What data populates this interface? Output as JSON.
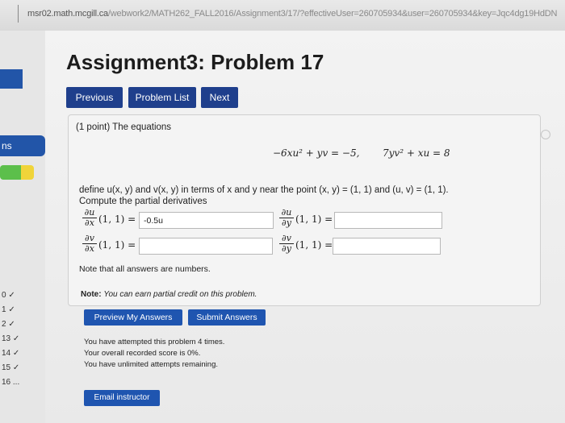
{
  "browser": {
    "url_host": "msr02.math.mcgill.ca",
    "url_path": "/webwork2/MATH262_FALL2016/Assignment3/17/?effectiveUser=260705934&user=260705934&key=Jqc4dg19HdDN"
  },
  "page": {
    "title": "Assignment3: Problem 17"
  },
  "nav": {
    "previous": "Previous",
    "problem_list": "Problem List",
    "next": "Next"
  },
  "sidebar": {
    "tab_label": "ns",
    "problems": [
      "0 ✓",
      "1 ✓",
      "2 ✓",
      "13 ✓",
      "14 ✓",
      "15 ✓",
      "16 ..."
    ]
  },
  "problem": {
    "points": "(1 point) The equations",
    "eq1": "−6xu² + yv = −5,",
    "eq2": "7yv² + xu = 8",
    "define_text": "define u(x, y) and v(x, y) in terms of x and y near the point (x, y) = (1, 1) and (u, v) = (1, 1).",
    "compute_text": "Compute the partial derivatives",
    "du_dx": {
      "num": "∂u",
      "den": "∂x",
      "point": "(1, 1) =",
      "value": "-0.5u"
    },
    "du_dy": {
      "num": "∂u",
      "den": "∂y",
      "point": "(1, 1) =",
      "value": ""
    },
    "dv_dx": {
      "num": "∂v",
      "den": "∂x",
      "point": "(1, 1) =",
      "value": ""
    },
    "dv_dy": {
      "num": "∂v",
      "den": "∂y",
      "point": "(1, 1) =",
      "value": ""
    },
    "note_numbers": "Note that all answers are numbers."
  },
  "partial_credit": {
    "label": "Note:",
    "text": "You can earn partial credit on this problem."
  },
  "actions": {
    "preview": "Preview My Answers",
    "submit": "Submit Answers"
  },
  "status": {
    "attempts": "You have attempted this problem 4 times.",
    "score": "Your overall recorded score is 0%.",
    "remaining": "You have unlimited attempts remaining."
  },
  "email_button": "Email instructor",
  "colors": {
    "nav_button": "#1f3f8c",
    "action_button": "#1f55b0",
    "sidebar_blue": "#2255a8"
  }
}
